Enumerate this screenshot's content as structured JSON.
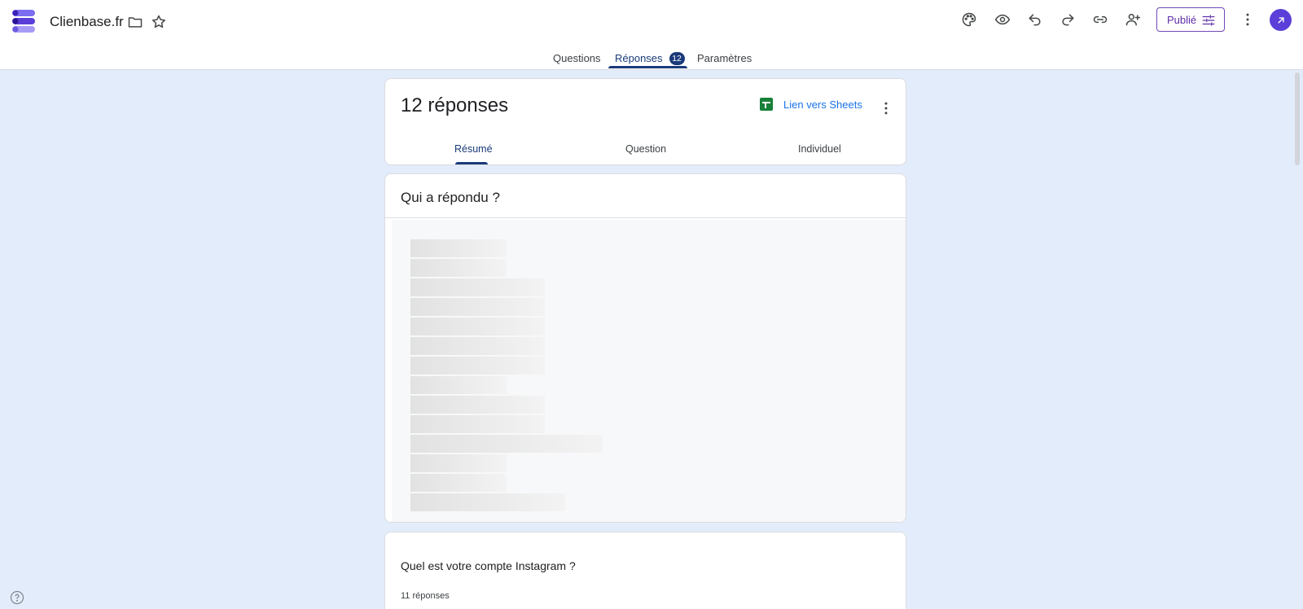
{
  "header": {
    "app_title": "Clienbase.fr",
    "publish_label": "Publié"
  },
  "main_tabs": [
    {
      "label": "Questions"
    },
    {
      "label": "Réponses",
      "badge": "12"
    },
    {
      "label": "Paramètres"
    }
  ],
  "summary_card": {
    "title": "12 réponses",
    "sheets_link": "Lien vers Sheets",
    "tabs": [
      {
        "label": "Résumé"
      },
      {
        "label": "Question"
      },
      {
        "label": "Individuel"
      }
    ]
  },
  "who_card": {
    "title": "Qui a répondu ?"
  },
  "insta_card": {
    "question": "Quel est votre compte Instagram ?",
    "count": "11 réponses"
  },
  "colors": {
    "accent": "#1a3a7a",
    "publish": "#5f2ea8",
    "sheets": "#188038",
    "link": "#1a73e8",
    "background": "#e3ecfb"
  }
}
